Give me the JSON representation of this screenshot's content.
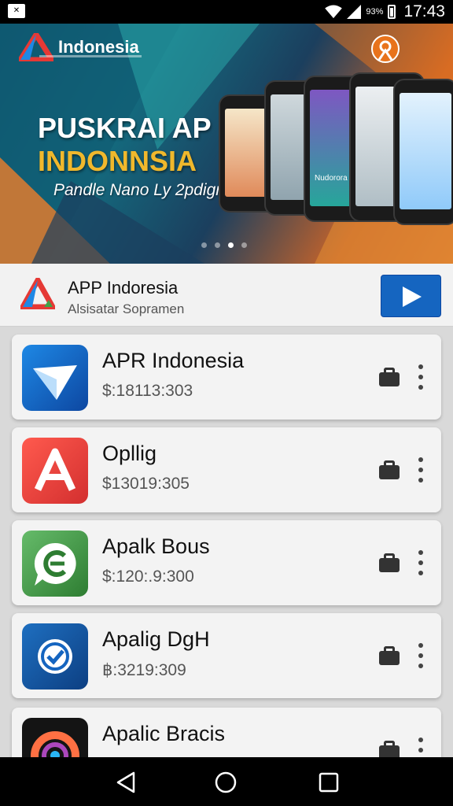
{
  "status_bar": {
    "battery_percent": "93%",
    "time": "17:43"
  },
  "banner": {
    "brand": "Indonesia",
    "headline_line1": "PUSKRAI AP",
    "headline_line2": "INDONNSIA",
    "tagline": "Pandle Nano Ly 2pdign",
    "phone_label": "Nudorora",
    "carousel_dots": 4,
    "active_dot": 3
  },
  "app_header": {
    "title": "APP Indoresia",
    "subtitle": "Alsisatar Sopramen"
  },
  "apps": [
    {
      "name": "APR Indonesia",
      "meta": "$:18113:303",
      "icon": "paper-plane-icon"
    },
    {
      "name": "Opllig",
      "meta": "$13019:305",
      "icon": "letter-a-icon"
    },
    {
      "name": "Apalk Bous",
      "meta": "$:120:.9:300",
      "icon": "chat-e-icon"
    },
    {
      "name": "Apalig DgH",
      "meta": "฿:3219:309",
      "icon": "check-circle-icon"
    },
    {
      "name": "Apalic Bracis",
      "meta": "",
      "icon": "colorful-ring-icon"
    }
  ],
  "colors": {
    "play_button": "#1565c0",
    "headline_accent": "#f0b82c",
    "list_background": "#d9d9d9"
  }
}
